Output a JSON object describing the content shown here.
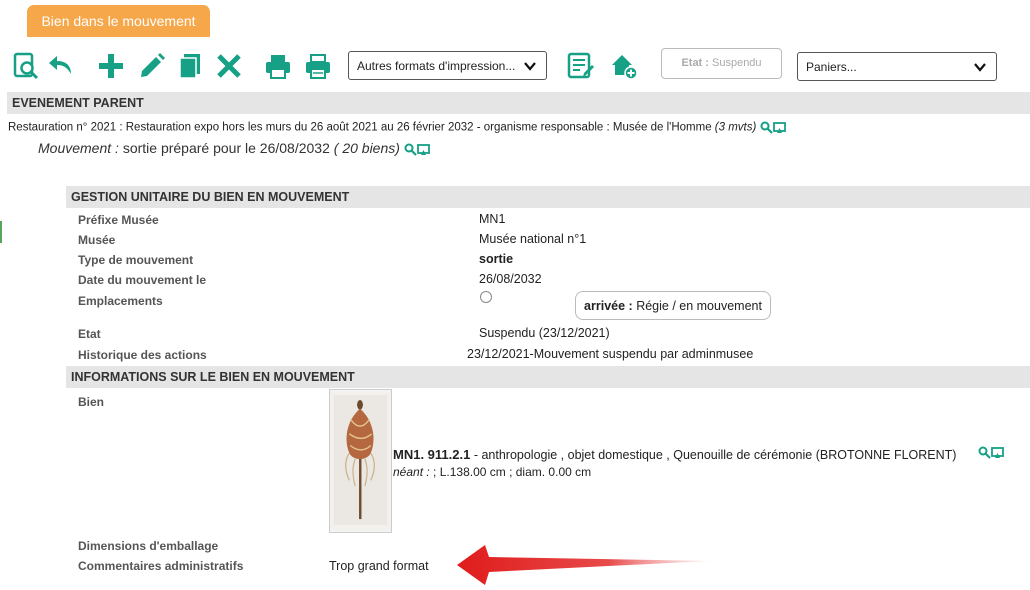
{
  "tab": {
    "label": "Bien dans le mouvement"
  },
  "toolbar": {
    "icons": [
      "preview-search-icon",
      "undo-icon",
      "add-icon",
      "edit-pencil-icon",
      "copy-icon",
      "delete-x-icon",
      "print-icon",
      "print-alt-icon",
      "edit-list-icon",
      "home-add-icon"
    ],
    "formats_select": "Autres formats d'impression...",
    "etat_label": "Etat :",
    "etat_value": "Suspendu",
    "paniers_select": "Paniers..."
  },
  "evenement_parent": {
    "header": "EVENEMENT PARENT",
    "text": "Restauration n° 2021 : Restauration expo hors les murs du 26 août 2021 au 26 février 2032 - organisme responsable : Musée de l'Homme",
    "count": "(3 mvts)",
    "mouvement_label": "Mouvement :",
    "mouvement_text": "sortie préparé pour le 26/08/2032",
    "mouvement_count": "( 20 biens)"
  },
  "gestion": {
    "header": "GESTION UNITAIRE DU BIEN EN MOUVEMENT",
    "rows": [
      {
        "label": "Préfixe Musée",
        "value": "MN1"
      },
      {
        "label": "Musée",
        "value": "Musée national n°1"
      },
      {
        "label": "Type de mouvement",
        "value": "sortie"
      },
      {
        "label": "Date du mouvement le",
        "value": "26/08/2032"
      },
      {
        "label": "Emplacements",
        "value": ""
      },
      {
        "label": "Etat",
        "value": "Suspendu (23/12/2021)"
      },
      {
        "label": "Historique des actions",
        "value": "23/12/2021-Mouvement suspendu par adminmusee"
      }
    ],
    "emplacement_bold": "arrivée :",
    "emplacement_text": "Régie / en mouvement"
  },
  "informations": {
    "header": "INFORMATIONS SUR LE BIEN EN MOUVEMENT",
    "bien_label": "Bien",
    "bien_id": "MN1. 911.2.1",
    "bien_desc": "- anthropologie , objet domestique , Quenouille de cérémonie (BROTONNE FLORENT)",
    "dim_label": "néant :",
    "dim_text": "; L.138.00 cm ; diam. 0.00 cm",
    "emballage_label": "Dimensions d'emballage",
    "commentaires_label": "Commentaires administratifs",
    "commentaires_value": "Trop grand format"
  },
  "colors": {
    "accent": "#16a085",
    "tab": "#f6a74a",
    "arrow": "#e01b1b"
  }
}
